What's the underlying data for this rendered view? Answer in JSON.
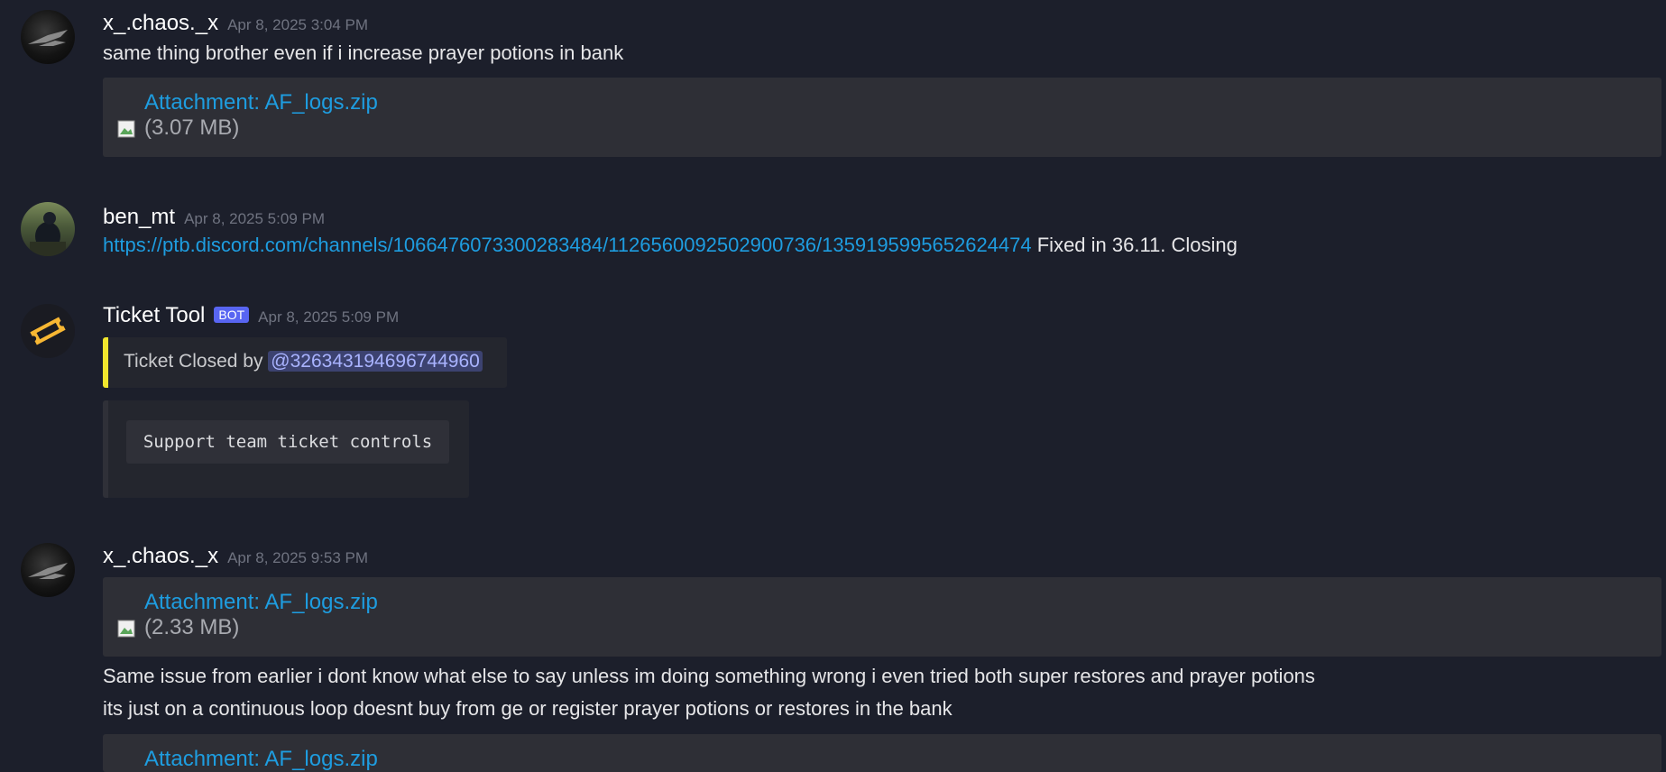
{
  "messages": [
    {
      "user": "x_.chaos._x",
      "time": "Apr 8, 2025 3:04 PM",
      "text": "same thing  brother even if i increase prayer potions in bank",
      "attachment": {
        "label": "Attachment: AF_logs.zip",
        "size": "(3.07 MB)"
      }
    },
    {
      "user": "ben_mt",
      "time": "Apr 8, 2025 5:09 PM",
      "link": "https://ptb.discord.com/channels/1066476073300283484/1126560092502900736/1359195995652624474",
      "text": " Fixed in 36.11. Closing"
    },
    {
      "user": "Ticket Tool",
      "badge": "BOT",
      "time": "Apr 8, 2025 5:09 PM",
      "embed_text": "Ticket Closed by ",
      "mention": "@326343194696744960",
      "controls_label": "Support team ticket controls"
    },
    {
      "user": "x_.chaos._x",
      "time": "Apr 8, 2025 9:53 PM",
      "attachment": {
        "label": "Attachment: AF_logs.zip",
        "size": "(2.33 MB)"
      },
      "line1": "Same issue from earlier i dont know what else to say unless im doing something wrong i even tried both super restores and prayer potions",
      "line2": "its just on a continuous loop doesnt buy from ge or register prayer potions or restores in the bank",
      "attachment2": {
        "label": "Attachment: AF_logs.zip"
      }
    }
  ],
  "colors": {
    "background": "#1c1f2b",
    "link": "#1e9de0",
    "embed_accent": "#f1e62d",
    "bot_badge": "#5865f2"
  },
  "icons": {
    "broken_image": "broken-image-icon",
    "ticket": "ticket-icon"
  }
}
